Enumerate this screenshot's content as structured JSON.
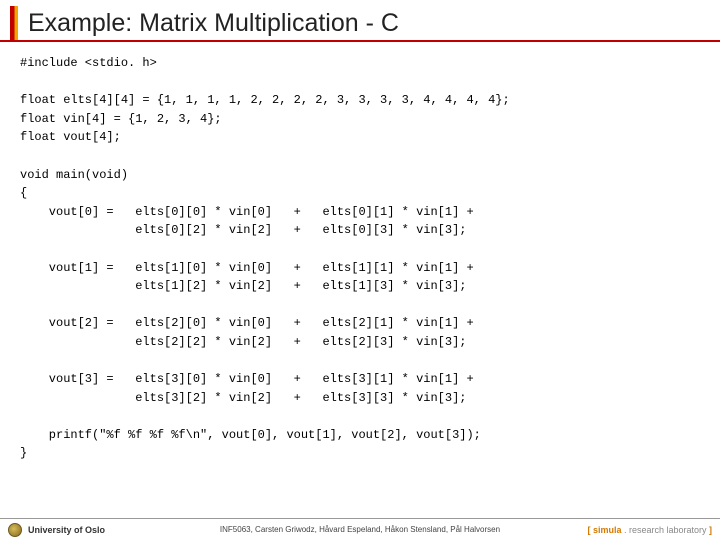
{
  "title": "Example: Matrix Multiplication - C",
  "code": "#include <stdio. h>\n\nfloat elts[4][4] = {1, 1, 1, 1, 2, 2, 2, 2, 3, 3, 3, 3, 4, 4, 4, 4};\nfloat vin[4] = {1, 2, 3, 4};\nfloat vout[4];\n\nvoid main(void)\n{\n    vout[0] =   elts[0][0] * vin[0]   +   elts[0][1] * vin[1] +\n                elts[0][2] * vin[2]   +   elts[0][3] * vin[3];\n\n    vout[1] =   elts[1][0] * vin[0]   +   elts[1][1] * vin[1] +\n                elts[1][2] * vin[2]   +   elts[1][3] * vin[3];\n\n    vout[2] =   elts[2][0] * vin[0]   +   elts[2][1] * vin[1] +\n                elts[2][2] * vin[2]   +   elts[2][3] * vin[3];\n\n    vout[3] =   elts[3][0] * vin[0]   +   elts[3][1] * vin[1] +\n                elts[3][2] * vin[2]   +   elts[3][3] * vin[3];\n\n    printf(\"%f %f %f %f\\n\", vout[0], vout[1], vout[2], vout[3]);\n}",
  "footer": {
    "left": "University of Oslo",
    "center": "INF5063, Carsten Griwodz, Håvard Espeland, Håkon Stensland, Pål Halvorsen",
    "right_bracket_open": "[ ",
    "right_name": "simula",
    "right_rest": " . research laboratory ",
    "right_bracket_close": "]"
  }
}
